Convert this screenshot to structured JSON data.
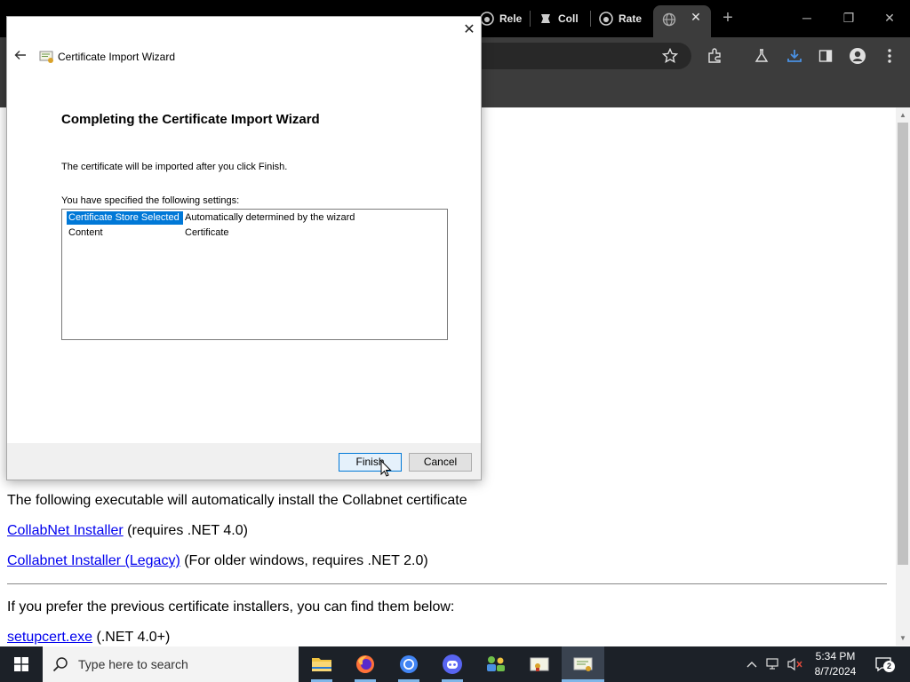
{
  "browser": {
    "tabs": [
      {
        "label": "Rele",
        "icon": "github-icon"
      },
      {
        "label": "Coll",
        "icon": "collabnet-icon"
      },
      {
        "label": "Rate",
        "icon": "github-icon"
      }
    ],
    "active_tab_icon": "globe-icon"
  },
  "page": {
    "intro": "The following executable will automatically install the Collabnet certificate",
    "link1": "CollabNet Installer",
    "link1_note": " (requires .NET 4.0)",
    "link2": "Collabnet Installer (Legacy)",
    "link2_note": " (For older windows, requires .NET 2.0)",
    "prev_text": "If you prefer the previous certificate installers, you can find them below:",
    "link3": "setupcert.exe",
    "link3_note": " (.NET 4.0+)"
  },
  "dialog": {
    "title": "Certificate Import Wizard",
    "heading": "Completing the Certificate Import Wizard",
    "description": "The certificate will be imported after you click Finish.",
    "settings_label": "You have specified the following settings:",
    "settings": [
      {
        "key": "Certificate Store Selected",
        "value": "Automatically determined by the wizard"
      },
      {
        "key": "Content",
        "value": "Certificate"
      }
    ],
    "finish_label": "Finish",
    "cancel_label": "Cancel"
  },
  "taskbar": {
    "search_placeholder": "Type here to search",
    "time": "5:34 PM",
    "date": "8/7/2024",
    "notification_count": "2"
  },
  "colors": {
    "selection": "#0078d7",
    "link": "#0000ee",
    "taskbar": "#1c2128"
  }
}
